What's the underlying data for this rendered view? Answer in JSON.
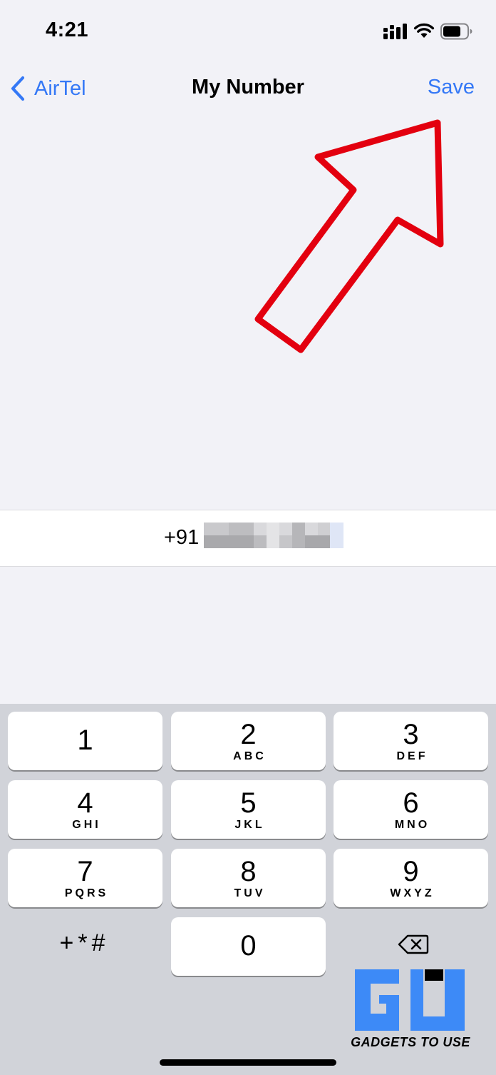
{
  "status_bar": {
    "time": "4:21"
  },
  "nav": {
    "back_label": "AirTel",
    "title": "My Number",
    "save_label": "Save"
  },
  "phone": {
    "prefix": "+91",
    "number_redacted": true
  },
  "keypad": {
    "keys": [
      {
        "digit": "1",
        "letters": ""
      },
      {
        "digit": "2",
        "letters": "ABC"
      },
      {
        "digit": "3",
        "letters": "DEF"
      },
      {
        "digit": "4",
        "letters": "GHI"
      },
      {
        "digit": "5",
        "letters": "JKL"
      },
      {
        "digit": "6",
        "letters": "MNO"
      },
      {
        "digit": "7",
        "letters": "PQRS"
      },
      {
        "digit": "8",
        "letters": "TUV"
      },
      {
        "digit": "9",
        "letters": "WXYZ"
      },
      {
        "digit": "0",
        "letters": ""
      }
    ],
    "symbols_label": "+*#"
  },
  "watermark": {
    "text": "GADGETS TO USE"
  },
  "colors": {
    "accent": "#3478f6",
    "annotation": "#e3000f",
    "background": "#f2f2f7",
    "keypad_bg": "#d1d3d9",
    "watermark": "#3d8af7"
  },
  "icons": [
    "signal-icon",
    "wifi-icon",
    "battery-icon",
    "chevron-left-icon",
    "delete-icon",
    "annotation-arrow"
  ]
}
